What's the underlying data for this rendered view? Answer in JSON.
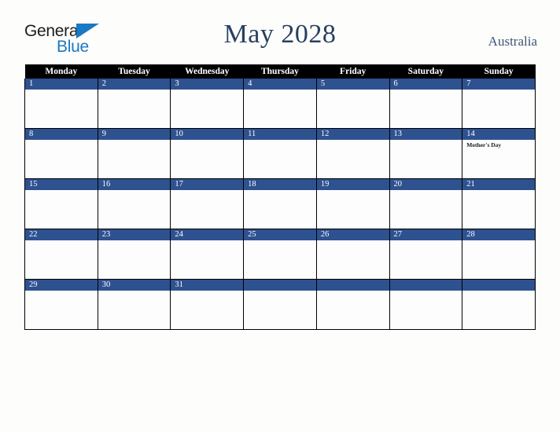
{
  "logo": {
    "word_one": "General",
    "word_two": "Blue",
    "triangle_color": "#1879c4",
    "text_color": "#1d1d1b"
  },
  "header": {
    "title": "May 2028",
    "country": "Australia",
    "title_color": "#27405f"
  },
  "calendar": {
    "weekday_headers": [
      "Monday",
      "Tuesday",
      "Wednesday",
      "Thursday",
      "Friday",
      "Saturday",
      "Sunday"
    ],
    "header_background": "#000000",
    "daynum_background": "#2e5190",
    "daynum_color": "#ffffff",
    "weeks": [
      {
        "days": [
          {
            "number": "1",
            "events": []
          },
          {
            "number": "2",
            "events": []
          },
          {
            "number": "3",
            "events": []
          },
          {
            "number": "4",
            "events": []
          },
          {
            "number": "5",
            "events": []
          },
          {
            "number": "6",
            "events": []
          },
          {
            "number": "7",
            "events": []
          }
        ]
      },
      {
        "days": [
          {
            "number": "8",
            "events": []
          },
          {
            "number": "9",
            "events": []
          },
          {
            "number": "10",
            "events": []
          },
          {
            "number": "11",
            "events": []
          },
          {
            "number": "12",
            "events": []
          },
          {
            "number": "13",
            "events": []
          },
          {
            "number": "14",
            "events": [
              "Mother's Day"
            ]
          }
        ]
      },
      {
        "days": [
          {
            "number": "15",
            "events": []
          },
          {
            "number": "16",
            "events": []
          },
          {
            "number": "17",
            "events": []
          },
          {
            "number": "18",
            "events": []
          },
          {
            "number": "19",
            "events": []
          },
          {
            "number": "20",
            "events": []
          },
          {
            "number": "21",
            "events": []
          }
        ]
      },
      {
        "days": [
          {
            "number": "22",
            "events": []
          },
          {
            "number": "23",
            "events": []
          },
          {
            "number": "24",
            "events": []
          },
          {
            "number": "25",
            "events": []
          },
          {
            "number": "26",
            "events": []
          },
          {
            "number": "27",
            "events": []
          },
          {
            "number": "28",
            "events": []
          }
        ]
      },
      {
        "days": [
          {
            "number": "29",
            "events": []
          },
          {
            "number": "30",
            "events": []
          },
          {
            "number": "31",
            "events": []
          },
          {
            "number": "",
            "events": []
          },
          {
            "number": "",
            "events": []
          },
          {
            "number": "",
            "events": []
          },
          {
            "number": "",
            "events": []
          }
        ]
      }
    ]
  }
}
